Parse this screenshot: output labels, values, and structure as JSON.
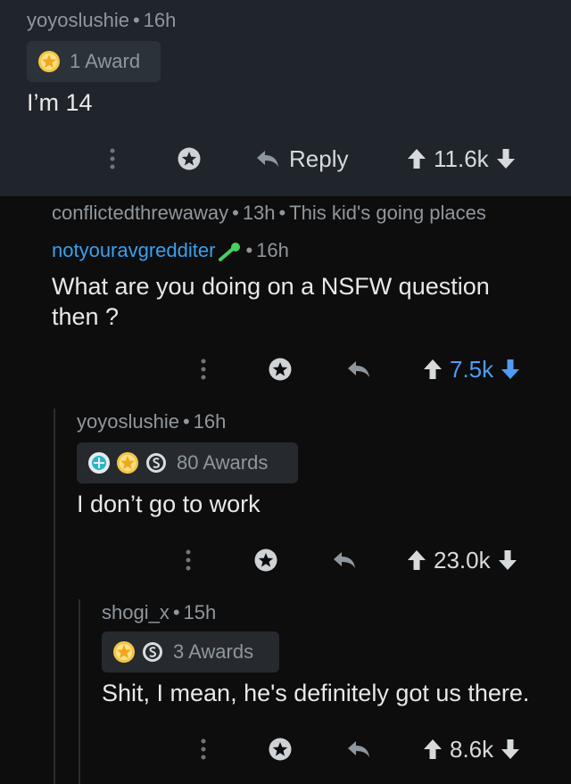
{
  "comments": [
    {
      "username": "yoyoslushie",
      "age": "16h",
      "awards_label": "1 Award",
      "body": "I’m 14",
      "reply_label": "Reply",
      "score": "11.6k"
    },
    {
      "collapsed_user": "conflictedthrewaway",
      "collapsed_age": "13h",
      "collapsed_flair": "This kid's going places"
    },
    {
      "username": "notyouravgredditer",
      "age": "16h",
      "body": "What are you doing on a NSFW question then ?",
      "score": "7.5k",
      "downvoted": true
    },
    {
      "username": "yoyoslushie",
      "age": "16h",
      "awards_label": "80 Awards",
      "body": "I don’t go to work",
      "score": "23.0k"
    },
    {
      "username": "shogi_x",
      "age": "15h",
      "awards_label": "3 Awards",
      "body": "Shit, I mean, he's definitely got us there.",
      "score": "8.6k"
    }
  ],
  "separator": "•",
  "colors": {
    "top_card_bg": "#1f252b",
    "thread_bg": "#0d0d0d",
    "meta_text": "#8f979e",
    "username_link": "#3aa0f0",
    "downvote_active": "#4f9cf5",
    "award_gold": "#f5c542"
  },
  "icons": {
    "more": "more-vertical-icon",
    "award": "award-icon",
    "reply": "reply-arrow-icon",
    "upvote": "upvote-arrow-icon",
    "downvote": "downvote-arrow-icon",
    "gold_award": "gold-star-award-icon",
    "silver_award": "silver-coin-award-icon",
    "helpful_award": "helpful-award-icon",
    "mod": "mod-wand-icon"
  }
}
